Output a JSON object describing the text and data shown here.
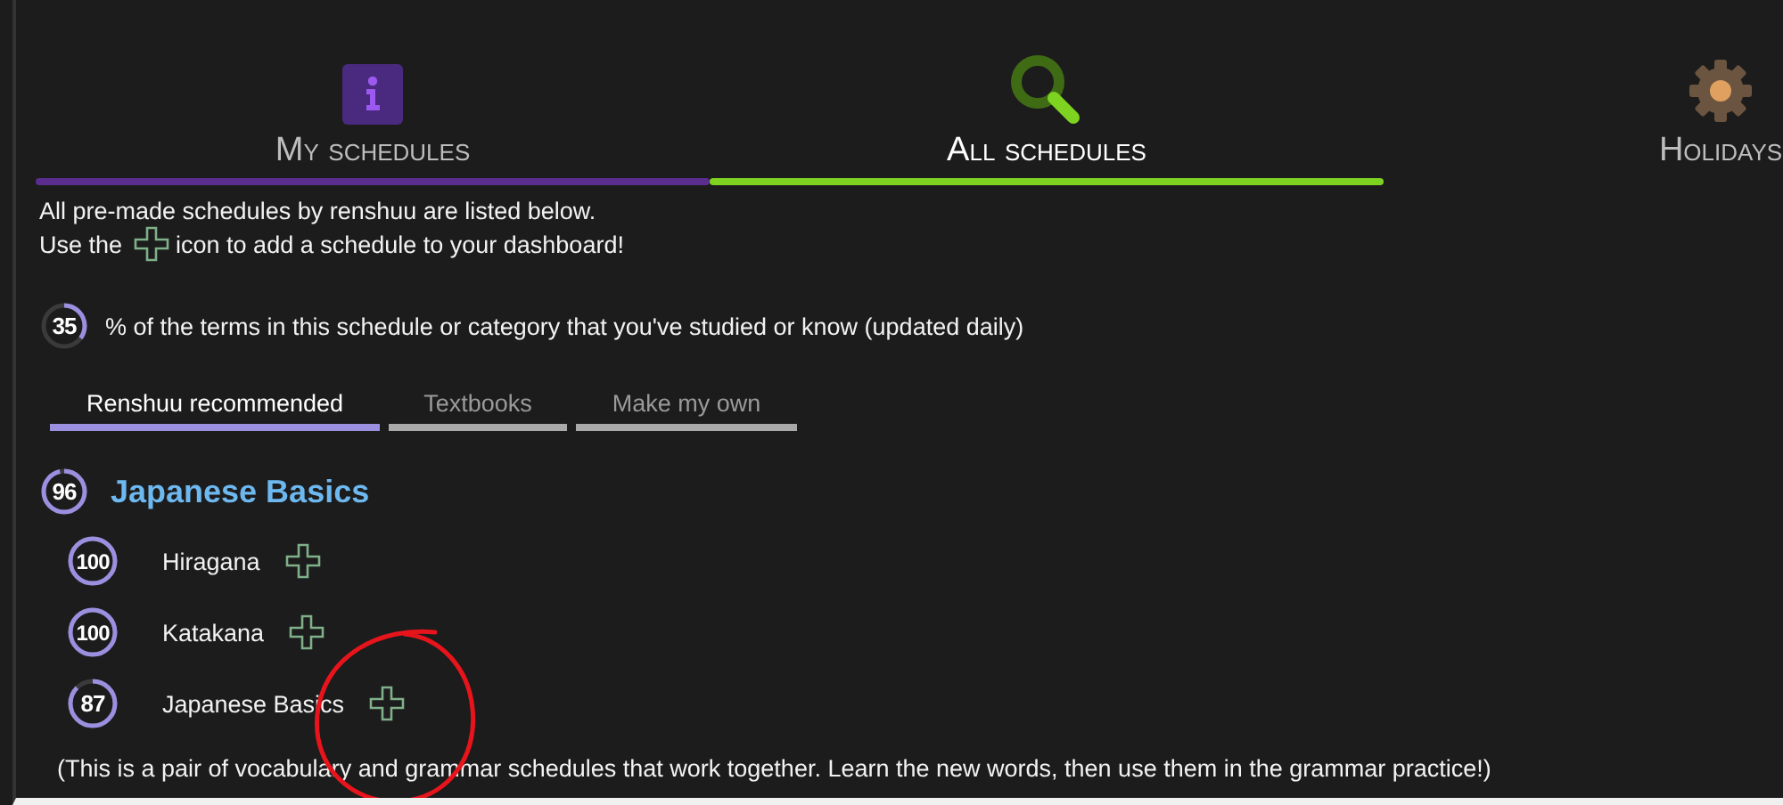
{
  "tabs": [
    {
      "label": "My schedules",
      "color": "#5b2d8e",
      "selected": false
    },
    {
      "label": "All schedules",
      "color": "#7ed321",
      "selected": true
    },
    {
      "label": "Holidays",
      "selected": false
    }
  ],
  "intro": {
    "line_1": "All pre-made schedules by renshuu are listed below.",
    "line_2_before": "Use the",
    "line_2_after": "icon to add a schedule to your dashboard!"
  },
  "legend": {
    "percent": "35",
    "text": "% of the terms in this schedule or category that you've studied or know (updated daily)"
  },
  "subtabs": [
    {
      "label": "Renshuu recommended",
      "selected": true
    },
    {
      "label": "Textbooks",
      "selected": false
    },
    {
      "label": "Make my own",
      "selected": false
    }
  ],
  "category": {
    "percent": "96",
    "title": "Japanese Basics",
    "schedules": [
      {
        "percent": "100",
        "name": "Hiragana"
      },
      {
        "percent": "100",
        "name": "Katakana"
      },
      {
        "percent": "87",
        "name": "Japanese Basics"
      }
    ],
    "note": "(This is a pair of vocabulary and grammar schedules that work together. Learn the new words, then use them in the grammar practice!)"
  },
  "annotation": {
    "kind": "circle",
    "color": "#e8141c"
  }
}
